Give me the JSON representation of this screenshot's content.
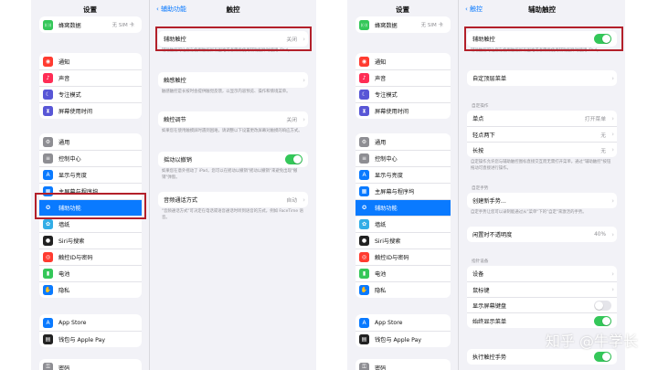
{
  "colors": {
    "accent": "#0a7aff",
    "toggle_on": "#34c759",
    "highlight": "#b3202a"
  },
  "left": {
    "sidebar": {
      "title": "设置",
      "groups": [
        [
          {
            "label": "蜂窝数据",
            "value": "无 SIM 卡",
            "icon": "antenna-icon",
            "color": "#34c759"
          }
        ],
        [
          {
            "label": "通知",
            "icon": "bell-icon",
            "color": "#ff3b30"
          },
          {
            "label": "声音",
            "icon": "speaker-icon",
            "color": "#ff2d55"
          },
          {
            "label": "专注模式",
            "icon": "moon-icon",
            "color": "#5856d6"
          },
          {
            "label": "屏幕使用时间",
            "icon": "hourglass-icon",
            "color": "#5856d6"
          }
        ],
        [
          {
            "label": "通用",
            "icon": "gear-icon",
            "color": "#8e8e93"
          },
          {
            "label": "控制中心",
            "icon": "switches-icon",
            "color": "#8e8e93"
          },
          {
            "label": "显示与亮度",
            "icon": "aa-icon",
            "color": "#0a7aff"
          },
          {
            "label": "主屏幕与程序坞",
            "icon": "grid-icon",
            "color": "#0a7aff"
          },
          {
            "label": "辅助功能",
            "icon": "accessibility-icon",
            "color": "#0a7aff",
            "selected": true
          },
          {
            "label": "墙纸",
            "icon": "flower-icon",
            "color": "#32ade6"
          },
          {
            "label": "Siri与搜索",
            "icon": "siri-icon",
            "color": "#222222"
          },
          {
            "label": "触控ID与密码",
            "icon": "fingerprint-icon",
            "color": "#ff3b30"
          },
          {
            "label": "电池",
            "icon": "battery-icon",
            "color": "#34c759"
          },
          {
            "label": "隐私",
            "icon": "hand-icon",
            "color": "#0a7aff"
          }
        ],
        [
          {
            "label": "App Store",
            "icon": "appstore-icon",
            "color": "#0a7aff"
          },
          {
            "label": "钱包与 Apple Pay",
            "icon": "wallet-icon",
            "color": "#222222"
          }
        ],
        [
          {
            "label": "密码",
            "icon": "key-icon",
            "color": "#8e8e93"
          }
        ]
      ]
    },
    "detail": {
      "back": "辅助功能",
      "title": "触控",
      "assistive": {
        "label": "辅助触控",
        "value": "关闭",
        "footer": "辅助触控可让您在使用触控屏有困难或者需要使用辅助配件时使用 iPad。"
      },
      "haptic": {
        "label": "触感触控",
        "footer": "触感触控是长按时会提供触觉反馈，以显示内容预览、操作和情境菜单。"
      },
      "accommodations": {
        "label": "触控调节",
        "value": "关闭",
        "footer": "如果您在使用触摸屏时遇到困难，请调整以下设置更改屏幕对触摸的响应方式。"
      },
      "shake": {
        "label": "摇动以撤销",
        "on": true,
        "footer": "如果您在意外摇动了 iPad，您可以在摇动以撤销\"摇动以撤销\"来避免出现\"撤销\"弹窗。"
      },
      "audio": {
        "label": "音频通话方式",
        "value": "自动",
        "footer": "\"音频通话方式\"可决定在电话或语音通话时听到语音的方式，例如 FaceTime 语音。"
      }
    }
  },
  "right": {
    "sidebar": {
      "title": "设置",
      "groups": [
        [
          {
            "label": "蜂窝数据",
            "value": "无 SIM 卡",
            "icon": "antenna-icon",
            "color": "#34c759"
          }
        ],
        [
          {
            "label": "通知",
            "icon": "bell-icon",
            "color": "#ff3b30"
          },
          {
            "label": "声音",
            "icon": "speaker-icon",
            "color": "#ff2d55"
          },
          {
            "label": "专注模式",
            "icon": "moon-icon",
            "color": "#5856d6"
          },
          {
            "label": "屏幕使用时间",
            "icon": "hourglass-icon",
            "color": "#5856d6"
          }
        ],
        [
          {
            "label": "通用",
            "icon": "gear-icon",
            "color": "#8e8e93"
          },
          {
            "label": "控制中心",
            "icon": "switches-icon",
            "color": "#8e8e93"
          },
          {
            "label": "显示与亮度",
            "icon": "aa-icon",
            "color": "#0a7aff"
          },
          {
            "label": "主屏幕与程序坞",
            "icon": "grid-icon",
            "color": "#0a7aff"
          },
          {
            "label": "辅助功能",
            "icon": "accessibility-icon",
            "color": "#0a7aff",
            "selected": true
          },
          {
            "label": "墙纸",
            "icon": "flower-icon",
            "color": "#32ade6"
          },
          {
            "label": "Siri与搜索",
            "icon": "siri-icon",
            "color": "#222222"
          },
          {
            "label": "触控ID与密码",
            "icon": "fingerprint-icon",
            "color": "#ff3b30"
          },
          {
            "label": "电池",
            "icon": "battery-icon",
            "color": "#34c759"
          },
          {
            "label": "隐私",
            "icon": "hand-icon",
            "color": "#0a7aff"
          }
        ],
        [
          {
            "label": "App Store",
            "icon": "appstore-icon",
            "color": "#0a7aff"
          },
          {
            "label": "钱包与 Apple Pay",
            "icon": "wallet-icon",
            "color": "#222222"
          }
        ],
        [
          {
            "label": "密码",
            "icon": "key-icon",
            "color": "#8e8e93"
          }
        ]
      ]
    },
    "detail": {
      "back": "触控",
      "title": "辅助触控",
      "assistive": {
        "label": "辅助触控",
        "on": true,
        "footer": "辅助触控可让您在使用触控屏有困难或者需要使用辅助配件时使用 iPad。"
      },
      "custom_menu": {
        "label": "自定顶层菜单"
      },
      "custom_actions": {
        "header": "自定操作",
        "rows": [
          {
            "label": "单点",
            "value": "打开菜单"
          },
          {
            "label": "轻点两下",
            "value": "无"
          },
          {
            "label": "长按",
            "value": "无"
          }
        ],
        "footer": "自定操作允许您与辅助触控图标直接交互而无需打开菜单。通过\"辅助触控\"按钮拖动可直接进行操作。"
      },
      "custom_gestures": {
        "header": "自定手势",
        "label": "创建新手势...",
        "footer": "自定手势让您可以录制能通过从\"菜单\"下的\"自定\"来激活的手势。"
      },
      "idle_opacity": {
        "label": "闲置时不透明度",
        "value": "40%"
      },
      "pointer_devices": {
        "header": "指针设备",
        "rows": [
          {
            "label": "设备"
          },
          {
            "label": "鼠标键"
          },
          {
            "label": "显示屏幕键盘",
            "toggle": false
          },
          {
            "label": "始终显示菜单",
            "toggle": true
          }
        ]
      },
      "perform_gestures": {
        "label": "执行触控手势",
        "on": true
      }
    }
  },
  "watermark": "知乎 @牛学长"
}
